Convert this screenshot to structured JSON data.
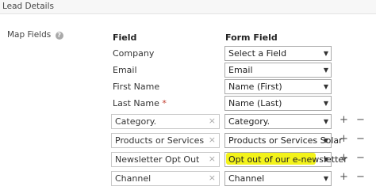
{
  "section": {
    "title": "Lead Details"
  },
  "map_fields": {
    "label": "Map Fields",
    "help_icon": "?"
  },
  "columns": {
    "field": "Field",
    "form_field": "Form Field"
  },
  "static_fields": {
    "company": "Company",
    "email": "Email",
    "first_name": "First Name",
    "last_name": "Last Name",
    "required_marker": "*"
  },
  "custom_fields": [
    {
      "value": "Category."
    },
    {
      "value": "Products or Services"
    },
    {
      "value": "Newsletter Opt Out"
    },
    {
      "value": "Channel"
    }
  ],
  "selects": [
    {
      "value": "Select a Field"
    },
    {
      "value": "Email"
    },
    {
      "value": "Name (First)"
    },
    {
      "value": "Name (Last)"
    },
    {
      "value": "Category."
    },
    {
      "value": "Products or Services Solar"
    },
    {
      "value": "Opt out of our e-newsletter"
    },
    {
      "value": "Channel"
    }
  ],
  "icons": {
    "clear": "×",
    "add": "+",
    "remove": "−",
    "caret": "▼"
  },
  "colors": {
    "highlight": "#f3f31b",
    "required": "#c0392b"
  }
}
